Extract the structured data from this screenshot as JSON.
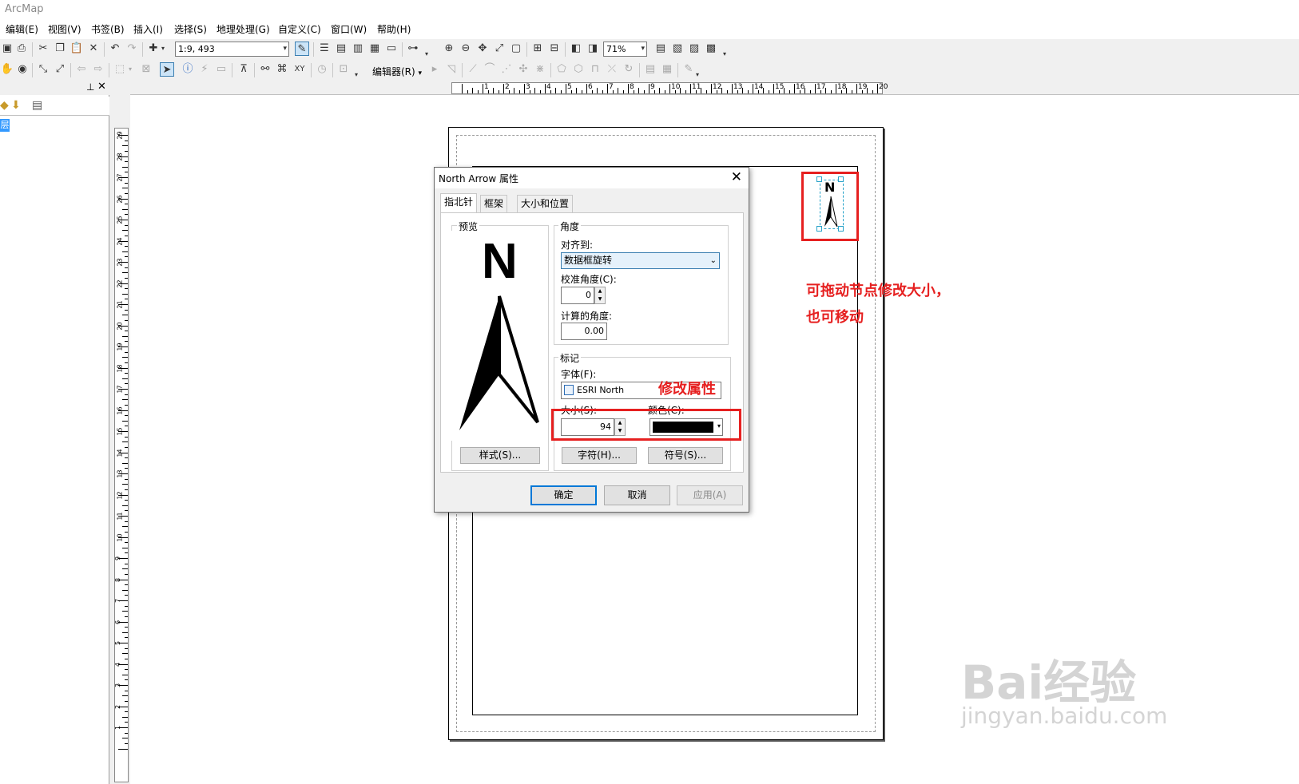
{
  "app": {
    "title": "ArcMap"
  },
  "menu": [
    "编辑(E)",
    "视图(V)",
    "书签(B)",
    "插入(I)",
    "选择(S)",
    "地理处理(G)",
    "自定义(C)",
    "窗口(W)",
    "帮助(H)"
  ],
  "toolbar": {
    "scale_value": "1:9, 493",
    "zoom_value": "71%",
    "editor_label": "编辑器(R)"
  },
  "toc": {
    "layer_glyph": "层"
  },
  "ruler": {
    "horizontal": [
      "1",
      "2",
      "3",
      "4",
      "5",
      "6",
      "7",
      "8",
      "9",
      "10",
      "11",
      "12",
      "13",
      "14",
      "15",
      "16",
      "17",
      "18",
      "19",
      "20"
    ],
    "vertical": [
      "29",
      "28",
      "27",
      "26",
      "25",
      "24",
      "23",
      "22",
      "21",
      "20",
      "19",
      "18",
      "17",
      "16",
      "15",
      "14",
      "13",
      "12",
      "11",
      "10",
      "9",
      "8",
      "7",
      "6",
      "5",
      "4",
      "3",
      "2",
      "1"
    ]
  },
  "map": {
    "north_arrow_letter": "N"
  },
  "annotations": {
    "drag_hint_line1": "可拖动节点修改大小，",
    "drag_hint_line2": "也可移动",
    "modify_props": "修改属性"
  },
  "dialog": {
    "title": "North Arrow 属性",
    "tabs": [
      "指北针",
      "框架",
      "大小和位置"
    ],
    "preview_label": "预览",
    "preview_letter": "N",
    "style_button": "样式(S)...",
    "angle_group": "角度",
    "align_label": "对齐到:",
    "align_value": "数据框旋转",
    "calibration_label": "校准角度(C):",
    "calibration_value": "0",
    "computed_label": "计算的角度:",
    "computed_value": "0.00",
    "marker_group": "标记",
    "font_label": "字体(F):",
    "font_value": "ESRI North",
    "size_label": "大小(S):",
    "size_value": "94",
    "color_label": "颜色(C):",
    "color_value": "#000000",
    "char_button": "字符(H)...",
    "symbol_button": "符号(S)...",
    "ok_button": "确定",
    "cancel_button": "取消",
    "apply_button": "应用(A)"
  },
  "watermark": {
    "line1": "Bai经验",
    "line2": "jingyan.baidu.com"
  },
  "colors": {
    "annotation_red": "#e62020",
    "selection_cyan": "#29a3c9"
  }
}
